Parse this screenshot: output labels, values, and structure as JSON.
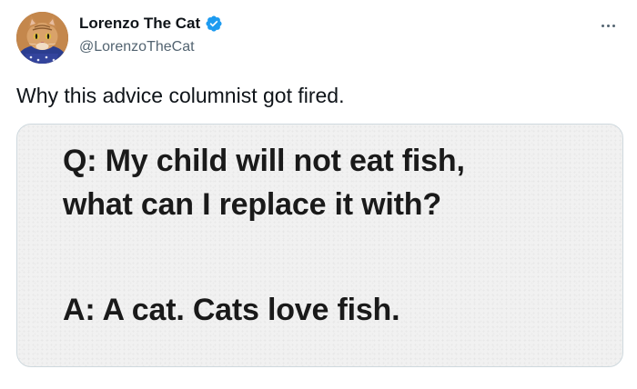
{
  "author": {
    "display_name": "Lorenzo The Cat",
    "handle": "@LorenzoTheCat",
    "verified": true,
    "avatar_icon": "cat-avatar",
    "verified_icon": "verified-badge-icon",
    "verified_color": "#1d9bf0"
  },
  "tweet": {
    "text": "Why this advice columnist got fired.",
    "more_icon": "more-options-icon"
  },
  "media": {
    "question_line_1": "Q:  My child will not eat fish,",
    "question_line_2": "what can I replace it with?",
    "answer_line": "A:  A cat. Cats love fish."
  },
  "colors": {
    "text_primary": "#0f1419",
    "text_secondary": "#536471",
    "border": "#cfd9de",
    "media_background": "#f1f1f1"
  }
}
